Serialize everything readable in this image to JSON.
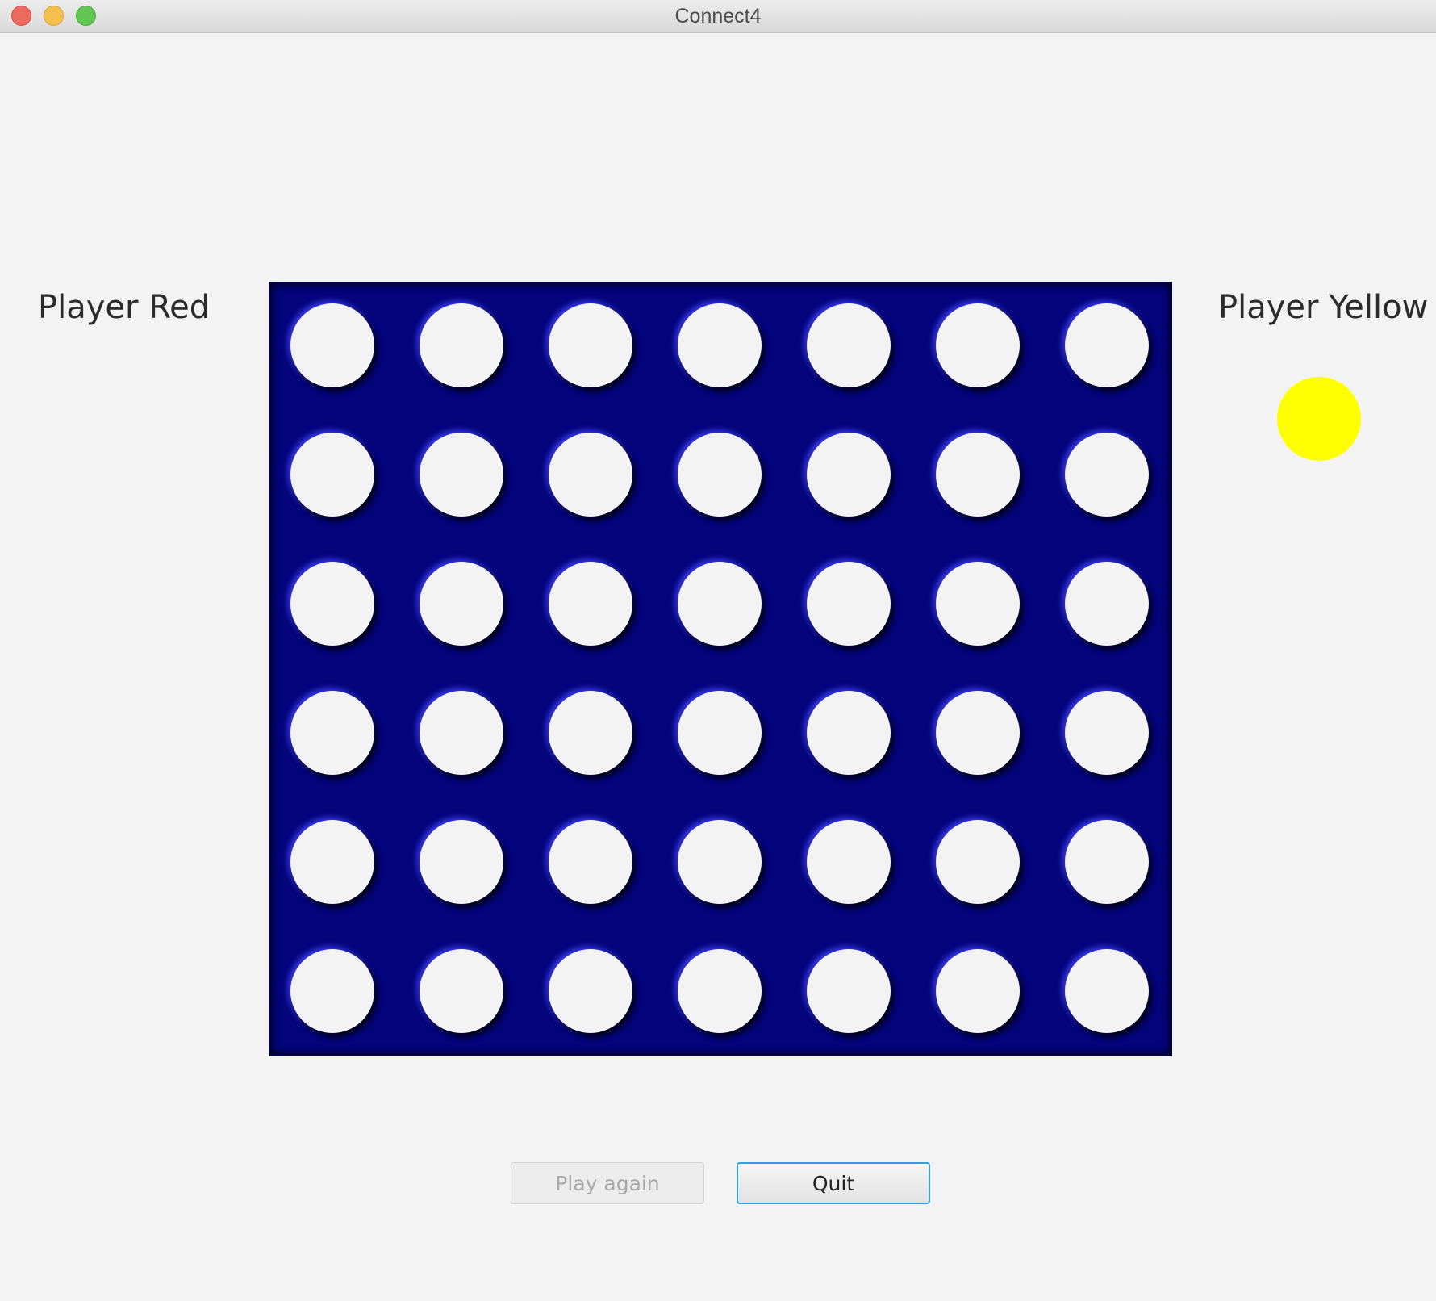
{
  "window": {
    "title": "Connect4"
  },
  "players": {
    "red_label": "Player Red",
    "yellow_label": "Player Yellow",
    "current_turn_color": "#ffff00"
  },
  "board": {
    "rows": 6,
    "columns": 7,
    "color": "#04047c",
    "cells": [
      [
        "empty",
        "empty",
        "empty",
        "empty",
        "empty",
        "empty",
        "empty"
      ],
      [
        "empty",
        "empty",
        "empty",
        "empty",
        "empty",
        "empty",
        "empty"
      ],
      [
        "empty",
        "empty",
        "empty",
        "empty",
        "empty",
        "empty",
        "empty"
      ],
      [
        "empty",
        "empty",
        "empty",
        "empty",
        "empty",
        "empty",
        "empty"
      ],
      [
        "empty",
        "empty",
        "empty",
        "empty",
        "empty",
        "empty",
        "empty"
      ],
      [
        "empty",
        "empty",
        "empty",
        "empty",
        "empty",
        "empty",
        "empty"
      ]
    ]
  },
  "buttons": {
    "play_again_label": "Play again",
    "play_again_enabled": false,
    "quit_label": "Quit"
  }
}
